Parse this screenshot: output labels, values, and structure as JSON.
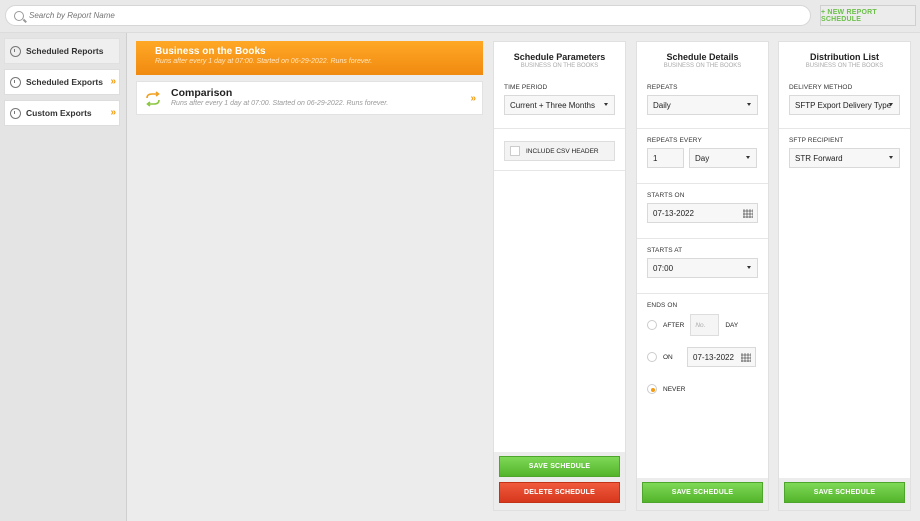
{
  "search": {
    "placeholder": "Search by Report Name"
  },
  "toolbar": {
    "new_label": "+ NEW REPORT SCHEDULE"
  },
  "nav": {
    "items": [
      {
        "label": "Scheduled Reports"
      },
      {
        "label": "Scheduled Exports"
      },
      {
        "label": "Custom Exports"
      }
    ]
  },
  "reports": [
    {
      "title": "Business on the Books",
      "subtitle": "Runs after every 1 day at 07:00. Started on 06-29-2022. Runs forever."
    },
    {
      "title": "Comparison",
      "subtitle": "Runs after every 1 day at 07:00. Started on 06-29-2022. Runs forever."
    }
  ],
  "params": {
    "title": "Schedule Parameters",
    "subtitle": "BUSINESS ON THE BOOKS",
    "time_period_label": "TIME PERIOD",
    "time_period_value": "Current + Three Months",
    "csv_label": "INCLUDE CSV HEADER",
    "save_label": "SAVE SCHEDULE",
    "delete_label": "DELETE SCHEDULE"
  },
  "details": {
    "title": "Schedule Details",
    "subtitle": "BUSINESS ON THE BOOKS",
    "repeats_label": "REPEATS",
    "repeats_value": "Daily",
    "repeats_every_label": "REPEATS EVERY",
    "repeats_every_num": "1",
    "repeats_every_unit": "Day",
    "starts_on_label": "STARTS ON",
    "starts_on_value": "07-13-2022",
    "starts_at_label": "STARTS AT",
    "starts_at_value": "07:00",
    "ends_on_label": "ENDS ON",
    "after_label": "AFTER",
    "after_placeholder": "No.",
    "day_label": "DAY",
    "on_label": "ON",
    "on_value": "07-13-2022",
    "never_label": "NEVER",
    "save_label": "SAVE SCHEDULE"
  },
  "distribution": {
    "title": "Distribution List",
    "subtitle": "BUSINESS ON THE BOOKS",
    "method_label": "DELIVERY METHOD",
    "method_value": "SFTP Export Delivery Type",
    "recipient_label": "SFTP RECIPIENT",
    "recipient_value": "STR Forward",
    "save_label": "SAVE SCHEDULE"
  },
  "colors": {
    "accent": "#f39c12",
    "save": "#5cbf2a",
    "delete": "#e0401f"
  }
}
